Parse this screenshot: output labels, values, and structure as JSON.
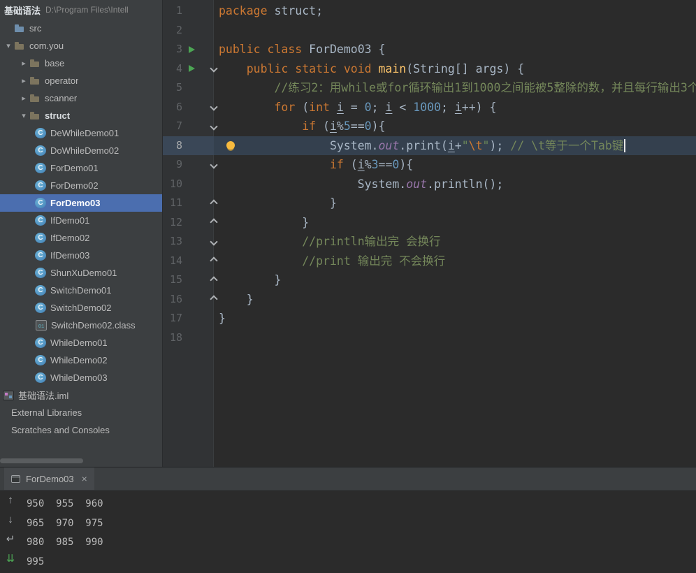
{
  "colors": {
    "panel_bg": "#3C3F41",
    "editor_bg": "#2B2B2B",
    "gutter_bg": "#313335",
    "selection_blue": "#4B6EAF",
    "keyword": "#CC7832",
    "number": "#6897BB",
    "string": "#6A8759",
    "comment": "#74875A",
    "static_field": "#9876AA",
    "method": "#FFC66B",
    "default_text": "#A9B7C6",
    "run_arrow_green": "#4CA554",
    "bulb_yellow": "#F7BA3E",
    "current_line_bg": "#34404E"
  },
  "project": {
    "title": "基础语法",
    "path": "D:\\Program Files\\Intell",
    "arrow_glyphs": {
      "down": "▾",
      "right": "▸"
    },
    "tree": [
      {
        "label": "src",
        "x": 20,
        "icon": "src"
      },
      {
        "label": "com.you",
        "x": 4,
        "arrow": "down",
        "icon": "package"
      },
      {
        "label": "base",
        "x": 26,
        "arrow": "right",
        "icon": "package"
      },
      {
        "label": "operator",
        "x": 26,
        "arrow": "right",
        "icon": "package"
      },
      {
        "label": "scanner",
        "x": 26,
        "arrow": "right",
        "icon": "package"
      },
      {
        "label": "struct",
        "x": 26,
        "arrow": "down",
        "icon": "package",
        "bold": true
      },
      {
        "label": "DeWhileDemo01",
        "x": 50,
        "icon": "class",
        "glyph": "C"
      },
      {
        "label": "DoWhileDemo02",
        "x": 50,
        "icon": "class",
        "glyph": "C"
      },
      {
        "label": "ForDemo01",
        "x": 50,
        "icon": "class",
        "glyph": "C"
      },
      {
        "label": "ForDemo02",
        "x": 50,
        "icon": "class",
        "glyph": "C"
      },
      {
        "label": "ForDemo03",
        "x": 50,
        "icon": "class",
        "glyph": "C",
        "selected": true
      },
      {
        "label": "IfDemo01",
        "x": 50,
        "icon": "class",
        "glyph": "C"
      },
      {
        "label": "IfDemo02",
        "x": 50,
        "icon": "class",
        "glyph": "C"
      },
      {
        "label": "IfDemo03",
        "x": 50,
        "icon": "class",
        "glyph": "C"
      },
      {
        "label": "ShunXuDemo01",
        "x": 50,
        "icon": "class",
        "glyph": "C"
      },
      {
        "label": "SwitchDemo01",
        "x": 50,
        "icon": "class",
        "glyph": "C"
      },
      {
        "label": "SwitchDemo02",
        "x": 50,
        "icon": "class",
        "glyph": "C"
      },
      {
        "label": "SwitchDemo02.class",
        "x": 50,
        "icon": "classfile",
        "glyph": "01"
      },
      {
        "label": "WhileDemo01",
        "x": 50,
        "icon": "class",
        "glyph": "C"
      },
      {
        "label": "WhileDemo02",
        "x": 50,
        "icon": "class",
        "glyph": "C"
      },
      {
        "label": "WhileDemo03",
        "x": 50,
        "icon": "class",
        "glyph": "C"
      },
      {
        "label": "基础语法.iml",
        "x": 4,
        "icon": "iml"
      },
      {
        "label": "External Libraries",
        "x": 16
      },
      {
        "label": "Scratches and Consoles",
        "x": 16
      }
    ]
  },
  "editor": {
    "lines": [
      {
        "num": 1,
        "segs": [
          {
            "t": "package",
            "c": "kw"
          },
          {
            "t": " struct;"
          }
        ]
      },
      {
        "num": 2,
        "segs": []
      },
      {
        "num": 3,
        "run": true,
        "segs": [
          {
            "t": "public class",
            "c": "kw"
          },
          {
            "t": " ForDemo03 {"
          }
        ]
      },
      {
        "num": 4,
        "run": true,
        "fold": "open",
        "segs": [
          {
            "t": "    "
          },
          {
            "t": "public static void",
            "c": "kw"
          },
          {
            "t": " "
          },
          {
            "t": "main",
            "c": "mth"
          },
          {
            "t": "(String[] args) {"
          }
        ]
      },
      {
        "num": 5,
        "segs": [
          {
            "t": "        "
          },
          {
            "t": "//练习2：用while或for循环输出1到1000之间能被5整除的数，并且每行输出3个",
            "c": "cmt"
          }
        ]
      },
      {
        "num": 6,
        "fold": "open",
        "segs": [
          {
            "t": "        "
          },
          {
            "t": "for",
            "c": "kw"
          },
          {
            "t": " ("
          },
          {
            "t": "int",
            "c": "kw"
          },
          {
            "t": " "
          },
          {
            "t": "i",
            "u": 1
          },
          {
            "t": " = "
          },
          {
            "t": "0",
            "c": "num"
          },
          {
            "t": "; "
          },
          {
            "t": "i",
            "u": 1
          },
          {
            "t": " < "
          },
          {
            "t": "1000",
            "c": "num"
          },
          {
            "t": "; "
          },
          {
            "t": "i",
            "u": 1
          },
          {
            "t": "++) {"
          }
        ]
      },
      {
        "num": 7,
        "fold": "open",
        "segs": [
          {
            "t": "            "
          },
          {
            "t": "if",
            "c": "kw"
          },
          {
            "t": " ("
          },
          {
            "t": "i",
            "u": 1
          },
          {
            "t": "%"
          },
          {
            "t": "5",
            "c": "num"
          },
          {
            "t": "=="
          },
          {
            "t": "0",
            "c": "num"
          },
          {
            "t": "){"
          }
        ]
      },
      {
        "num": 8,
        "current": true,
        "bulb": true,
        "caret": true,
        "segs": [
          {
            "t": "                System."
          },
          {
            "t": "out",
            "c": "fld"
          },
          {
            "t": ".print("
          },
          {
            "t": "i",
            "u": 1
          },
          {
            "t": "+"
          },
          {
            "t": "\"",
            "c": "str"
          },
          {
            "t": "\\t",
            "c": "esc"
          },
          {
            "t": "\"",
            "c": "str"
          },
          {
            "t": "); "
          },
          {
            "t": "// \\t等于一个Tab键",
            "c": "cmt"
          }
        ]
      },
      {
        "num": 9,
        "fold": "open",
        "segs": [
          {
            "t": "                "
          },
          {
            "t": "if",
            "c": "kw"
          },
          {
            "t": " ("
          },
          {
            "t": "i",
            "u": 1
          },
          {
            "t": "%"
          },
          {
            "t": "3",
            "c": "num"
          },
          {
            "t": "=="
          },
          {
            "t": "0",
            "c": "num"
          },
          {
            "t": "){"
          }
        ]
      },
      {
        "num": 10,
        "segs": [
          {
            "t": "                    System."
          },
          {
            "t": "out",
            "c": "fld"
          },
          {
            "t": ".println();"
          }
        ]
      },
      {
        "num": 11,
        "fold": "close",
        "segs": [
          {
            "t": "                }"
          }
        ]
      },
      {
        "num": 12,
        "fold": "close",
        "segs": [
          {
            "t": "            }"
          }
        ]
      },
      {
        "num": 13,
        "fold": "open",
        "segs": [
          {
            "t": "            "
          },
          {
            "t": "//println输出完 会换行",
            "c": "cmt"
          }
        ]
      },
      {
        "num": 14,
        "fold": "close",
        "segs": [
          {
            "t": "            "
          },
          {
            "t": "//print 输出完 不会换行",
            "c": "cmt"
          }
        ]
      },
      {
        "num": 15,
        "fold": "close",
        "segs": [
          {
            "t": "        }"
          }
        ]
      },
      {
        "num": 16,
        "fold": "close",
        "segs": [
          {
            "t": "    }"
          }
        ]
      },
      {
        "num": 17,
        "segs": [
          {
            "t": "}"
          }
        ]
      },
      {
        "num": 18,
        "segs": []
      }
    ]
  },
  "run": {
    "tab_label": "ForDemo03",
    "close_glyph": "×",
    "toolbar_icons": [
      {
        "name": "up-stack-trace-icon",
        "glyph": "↑"
      },
      {
        "name": "down-stack-trace-icon",
        "glyph": "↓"
      },
      {
        "name": "soft-wrap-icon",
        "glyph": "↵"
      },
      {
        "name": "scroll-to-end-icon",
        "glyph": "⇊",
        "color": "#4CA554"
      }
    ],
    "output": [
      "950\t955\t960",
      "965\t970\t975",
      "980\t985\t990",
      "995"
    ]
  }
}
